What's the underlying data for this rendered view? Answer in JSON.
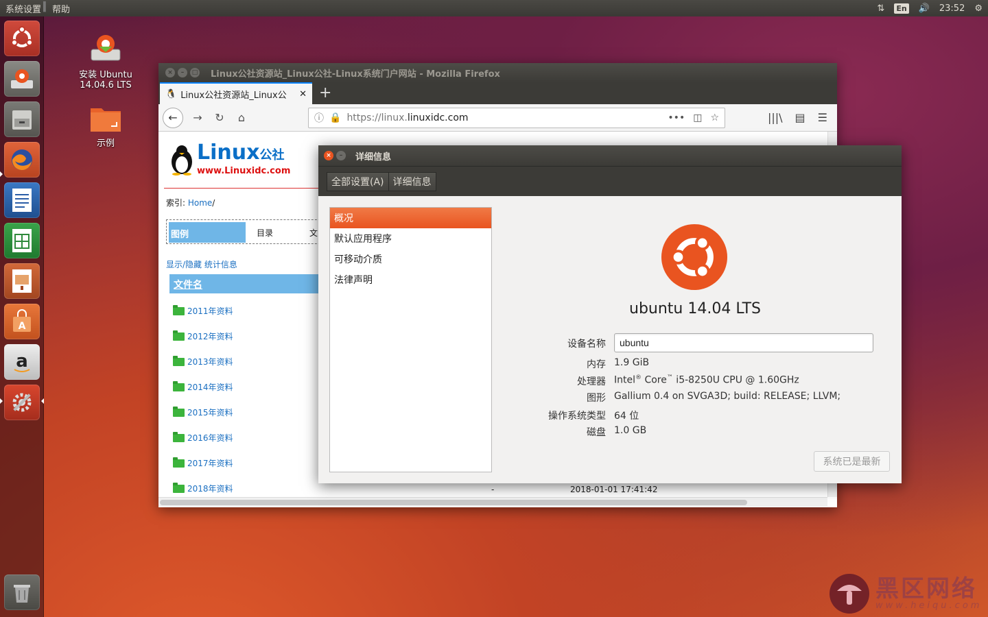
{
  "top_panel": {
    "menu": [
      "系统设置",
      "帮助"
    ],
    "lang": "En",
    "time": "23:52"
  },
  "desktop": {
    "icons": [
      {
        "label_line1": "安装 Ubuntu",
        "label_line2": "14.04.6 LTS"
      },
      {
        "label_line1": "示例",
        "label_line2": ""
      }
    ]
  },
  "firefox": {
    "window_title": "Linux公社资源站_Linux公社-Linux系统门户网站 - Mozilla Firefox",
    "tab_title": "Linux公社资源站_Linux公",
    "url_prefix": "https://linux.",
    "url_host": "linuxidc.com",
    "page": {
      "logo_name": "Linux",
      "logo_cn": "公社",
      "logo_url": "www.Linuxidc.com",
      "crumb_label": "索引: ",
      "crumb_link": "Home",
      "crumb_sep": "/",
      "tabs": [
        "图例",
        "目录",
        "文"
      ],
      "toggle_link": "显示/隐藏 统计信息",
      "column_header": "文件名",
      "files": [
        "2011年资料",
        "2012年资料",
        "2013年资料",
        "2014年资料",
        "2015年资料",
        "2016年资料",
        "2017年资料",
        "2018年资料"
      ],
      "last_row_size": "-",
      "last_row_date": "2018-01-01 17:41:42"
    }
  },
  "details": {
    "title": "详细信息",
    "breadcrumb": [
      "全部设置(A)",
      "详细信息"
    ],
    "side_items": [
      "概况",
      "默认应用程序",
      "可移动介质",
      "法律声明"
    ],
    "os_name": "ubuntu 14.04 LTS",
    "labels": {
      "device": "设备名称",
      "memory": "内存",
      "cpu": "处理器",
      "graphics": "图形",
      "os_type": "操作系统类型",
      "disk": "磁盘"
    },
    "device_name": "ubuntu",
    "memory": "1.9 GiB",
    "cpu_a": "Intel",
    "cpu_b": " Core",
    "cpu_c": " i5-8250U CPU @ 1.60GHz",
    "graphics": "Gallium 0.4 on SVGA3D; build: RELEASE;  LLVM;",
    "os_type": "64 位",
    "disk": "1.0 GB",
    "update_button": "系统已是最新"
  },
  "watermark": {
    "text": "黑区网络",
    "sub": "www.heiqu.com"
  },
  "colors": {
    "ubuntu_orange": "#e95420",
    "link_blue": "#1a6fc1",
    "accent_blue": "#6fb6e7"
  }
}
